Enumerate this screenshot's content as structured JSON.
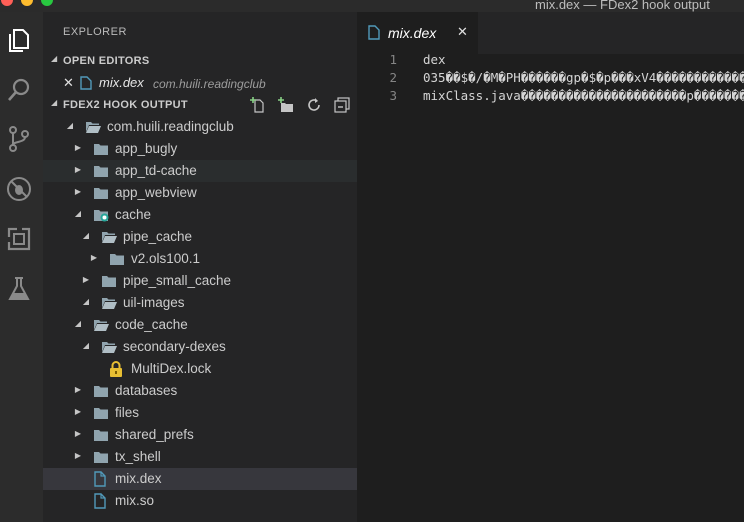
{
  "window": {
    "title": "mix.dex — FDex2 hook output"
  },
  "colors": {
    "accent_file": "#519aba",
    "selection": "#37373d",
    "lock": "#e8bf33",
    "activity_bg": "#2c2c2c",
    "sidebar_bg": "#252526",
    "editor_bg": "#1e1e1e"
  },
  "activity_icons": [
    "files-icon",
    "search-icon",
    "source-control-icon",
    "debug-icon",
    "extensions-icon",
    "flask-icon"
  ],
  "sidebar": {
    "title": "EXPLORER",
    "open_editors": {
      "header": "OPEN EDITORS",
      "items": [
        {
          "name": "mix.dex",
          "description": "com.huili.readingclub"
        }
      ]
    },
    "folder": {
      "header": "FDEX2 HOOK OUTPUT",
      "actions": [
        "new-file-icon",
        "new-folder-icon",
        "refresh-icon",
        "collapse-all-icon"
      ],
      "tree": [
        {
          "name": "com.huili.readingclub"
        },
        {
          "name": "app_bugly"
        },
        {
          "name": "app_td-cache"
        },
        {
          "name": "app_webview"
        },
        {
          "name": "cache"
        },
        {
          "name": "pipe_cache"
        },
        {
          "name": "v2.ols100.1"
        },
        {
          "name": "pipe_small_cache"
        },
        {
          "name": "uil-images"
        },
        {
          "name": "code_cache"
        },
        {
          "name": "secondary-dexes"
        },
        {
          "name": "MultiDex.lock"
        },
        {
          "name": "databases"
        },
        {
          "name": "files"
        },
        {
          "name": "shared_prefs"
        },
        {
          "name": "tx_shell"
        },
        {
          "name": "mix.dex"
        },
        {
          "name": "mix.so"
        }
      ]
    }
  },
  "editor": {
    "tab": {
      "label": "mix.dex"
    },
    "lines": [
      {
        "num": "1",
        "text": "dex"
      },
      {
        "num": "2",
        "text": "035��$�/�M�PH������gp�$�p���xV4������������"
      },
      {
        "num": "3",
        "text": "mixClass.java����������������������p����������"
      }
    ]
  }
}
